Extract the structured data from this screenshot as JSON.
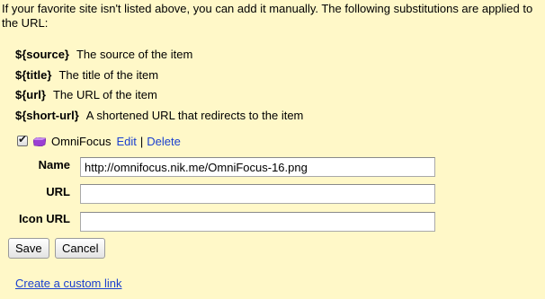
{
  "intro_text": "If your favorite site isn't listed above, you can add it manually. The following substitutions are applied to the URL:",
  "substitutions": [
    {
      "key": "${source}",
      "desc": "The source of the item"
    },
    {
      "key": "${title}",
      "desc": "The title of the item"
    },
    {
      "key": "${url}",
      "desc": "The URL of the item"
    },
    {
      "key": "${short-url}",
      "desc": "A shortened URL that redirects to the item"
    }
  ],
  "site": {
    "checked": true,
    "icon": "omnifocus-icon",
    "name": "OmniFocus",
    "edit_label": "Edit",
    "separator": "|",
    "delete_label": "Delete"
  },
  "form": {
    "name_label": "Name",
    "name_value": "http://omnifocus.nik.me/OmniFocus-16.png",
    "url_label": "URL",
    "url_value": "",
    "icon_url_label": "Icon URL",
    "icon_url_value": ""
  },
  "buttons": {
    "save_label": "Save",
    "cancel_label": "Cancel"
  },
  "custom_link_label": "Create a custom link",
  "colors": {
    "background": "#fff8c8",
    "link": "#1a3fcf",
    "icon_purple": "#9b3fd3"
  }
}
